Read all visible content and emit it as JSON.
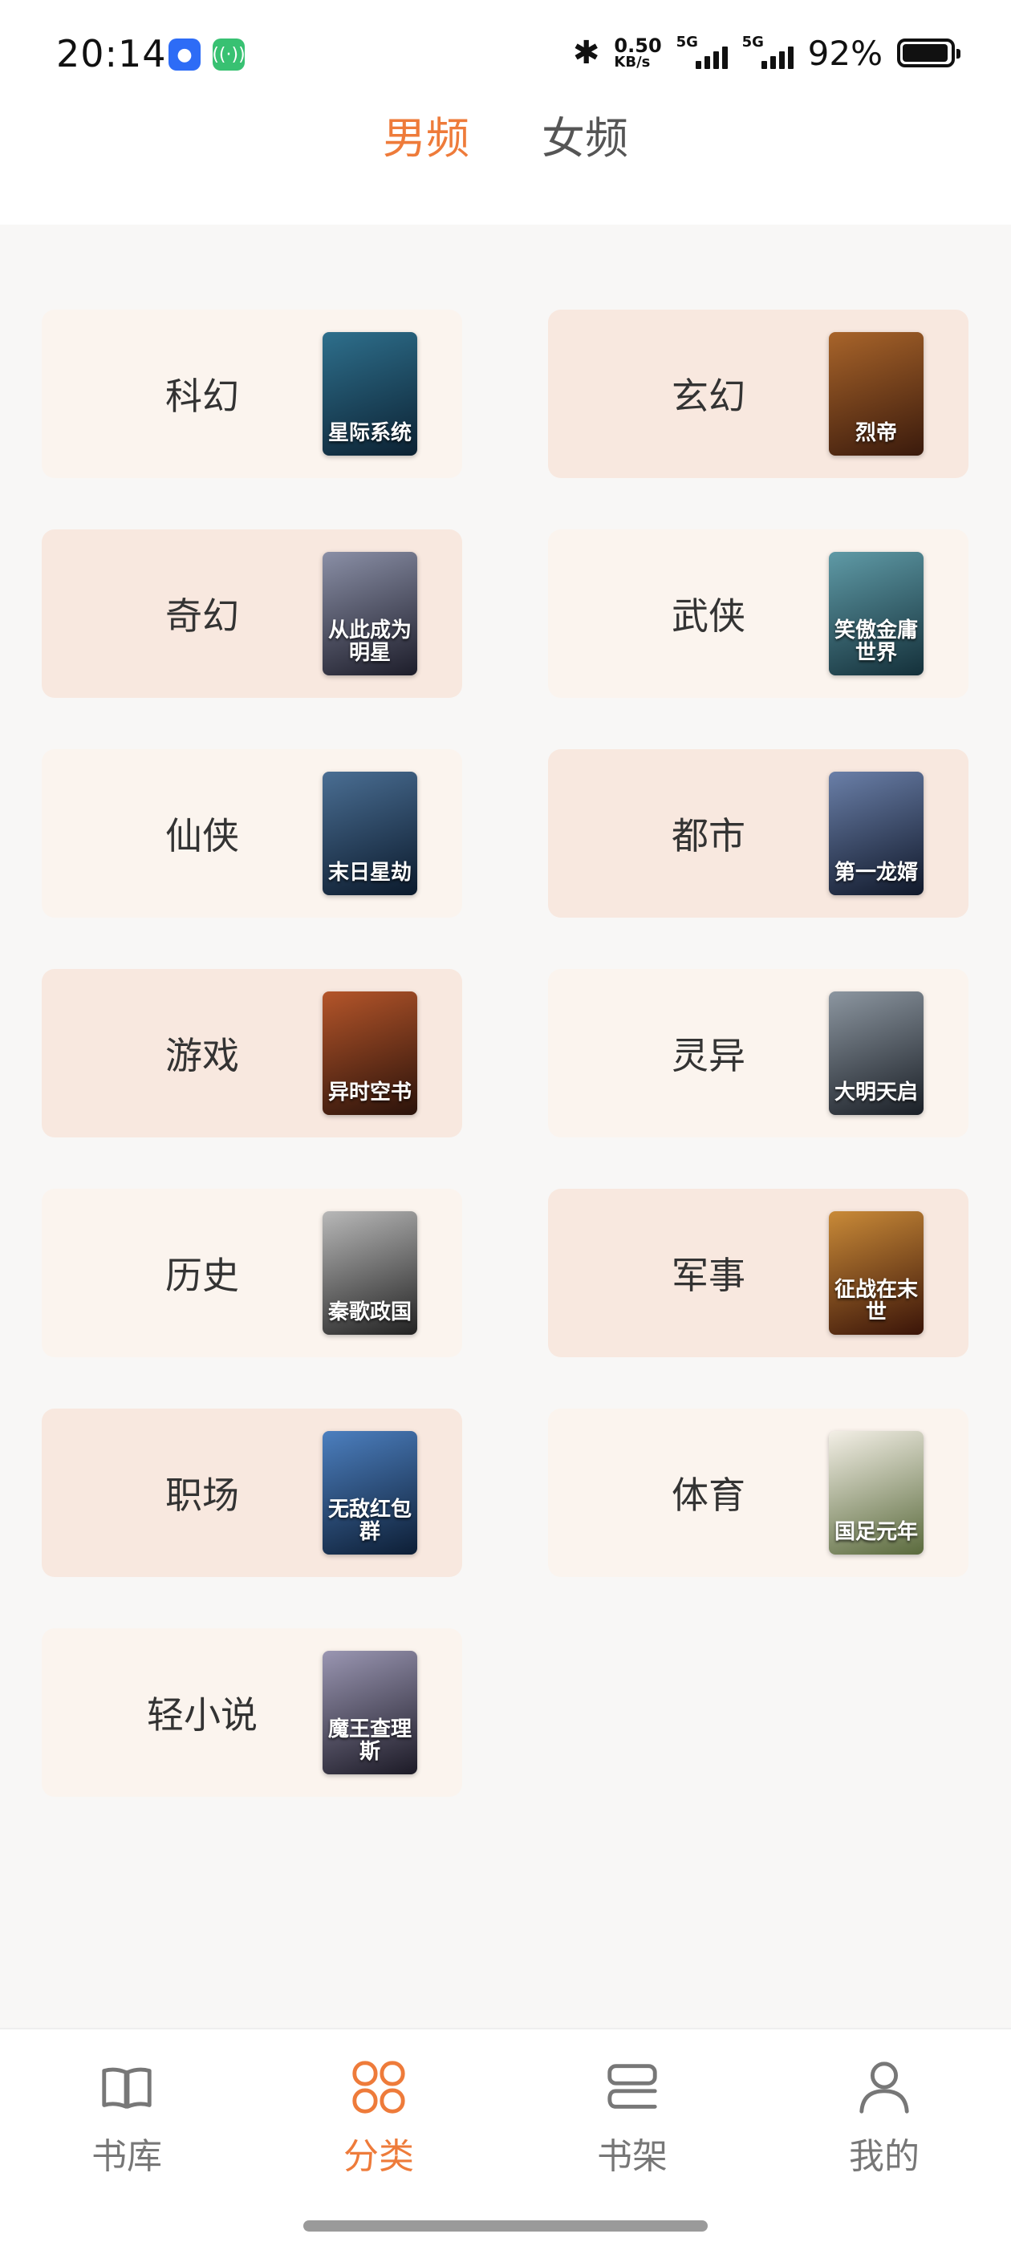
{
  "status_bar": {
    "time": "20:14",
    "net_speed_value": "0.50",
    "net_speed_unit": "KB/s",
    "sim1": "5G",
    "sim2": "5G",
    "battery": "92%"
  },
  "tabs": [
    {
      "label": "男频",
      "active": true
    },
    {
      "label": "女频",
      "active": false
    }
  ],
  "categories": [
    {
      "label": "科幻",
      "cover_title": "星际系统",
      "cover_colors": [
        "#0c2233",
        "#2e6f8c"
      ]
    },
    {
      "label": "玄幻",
      "cover_title": "烈帝",
      "cover_colors": [
        "#3a1a0c",
        "#a8642a"
      ]
    },
    {
      "label": "奇幻",
      "cover_title": "从此成为明星",
      "cover_colors": [
        "#1d1d2a",
        "#8a8fa6"
      ]
    },
    {
      "label": "武侠",
      "cover_title": "笑傲金庸世界",
      "cover_colors": [
        "#14303a",
        "#5f9aa6"
      ]
    },
    {
      "label": "仙侠",
      "cover_title": "末日星劫",
      "cover_colors": [
        "#0b1a2c",
        "#4a6e93"
      ]
    },
    {
      "label": "都市",
      "cover_title": "第一龙婿",
      "cover_colors": [
        "#10182a",
        "#6a7fa8"
      ]
    },
    {
      "label": "游戏",
      "cover_title": "异时空书",
      "cover_colors": [
        "#2a120a",
        "#b4552a"
      ]
    },
    {
      "label": "灵异",
      "cover_title": "大明天启",
      "cover_colors": [
        "#1a1f26",
        "#8c96a0"
      ]
    },
    {
      "label": "历史",
      "cover_title": "秦歌政国",
      "cover_colors": [
        "#222222",
        "#b8b8b8"
      ]
    },
    {
      "label": "军事",
      "cover_title": "征战在末世",
      "cover_colors": [
        "#3a1408",
        "#c98a38"
      ]
    },
    {
      "label": "职场",
      "cover_title": "无敌红包群",
      "cover_colors": [
        "#0d1e35",
        "#4c7fbf"
      ]
    },
    {
      "label": "体育",
      "cover_title": "国足元年",
      "cover_colors": [
        "#5a6a3c",
        "#f3efe6"
      ]
    },
    {
      "label": "轻小说",
      "cover_title": "魔王查理斯",
      "cover_colors": [
        "#1c1a26",
        "#9a96b2"
      ]
    }
  ],
  "bottom_nav": [
    {
      "label": "书库",
      "icon": "open-book-icon",
      "active": false
    },
    {
      "label": "分类",
      "icon": "category-grid-icon",
      "active": true
    },
    {
      "label": "书架",
      "icon": "bookshelf-icon",
      "active": false
    },
    {
      "label": "我的",
      "icon": "user-profile-icon",
      "active": false
    }
  ],
  "colors": {
    "accent": "#ee7b3a",
    "card_light": "#fbf4ee",
    "card_dark": "#f8e8df"
  }
}
